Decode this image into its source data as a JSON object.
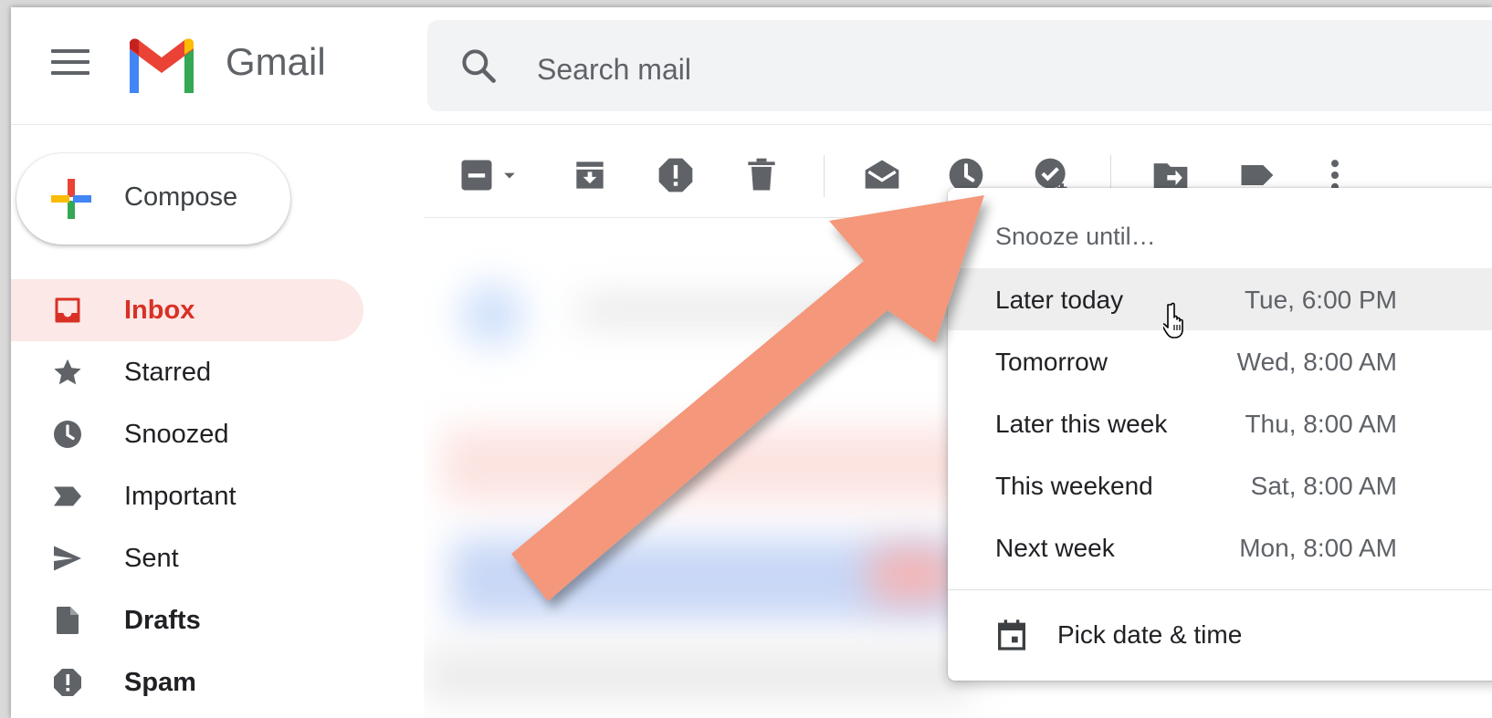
{
  "header": {
    "menu_icon": "hamburger-menu-icon",
    "app_title": "Gmail",
    "search": {
      "placeholder": "Search mail",
      "icon": "search-icon"
    }
  },
  "sidebar": {
    "compose_label": "Compose",
    "items": [
      {
        "label": "Inbox",
        "icon": "inbox-icon",
        "active": true
      },
      {
        "label": "Starred",
        "icon": "star-icon"
      },
      {
        "label": "Snoozed",
        "icon": "clock-icon"
      },
      {
        "label": "Important",
        "icon": "important-icon"
      },
      {
        "label": "Sent",
        "icon": "send-icon"
      },
      {
        "label": "Drafts",
        "icon": "draft-icon",
        "bold": true
      },
      {
        "label": "Spam",
        "icon": "spam-icon",
        "bold": true
      }
    ]
  },
  "toolbar": {
    "buttons": [
      "select-checkbox",
      "select-dropdown",
      "archive",
      "report-spam",
      "delete",
      "mark-as-read",
      "snooze",
      "add-to-tasks",
      "move-to",
      "labels",
      "more"
    ]
  },
  "snooze_menu": {
    "title": "Snooze until…",
    "options": [
      {
        "label": "Later today",
        "time": "Tue, 6:00 PM",
        "highlighted": true
      },
      {
        "label": "Tomorrow",
        "time": "Wed, 8:00 AM"
      },
      {
        "label": "Later this week",
        "time": "Thu, 8:00 AM"
      },
      {
        "label": "This weekend",
        "time": "Sat, 8:00 AM"
      },
      {
        "label": "Next week",
        "time": "Mon, 8:00 AM"
      }
    ],
    "pick_label": "Pick date & time"
  },
  "colors": {
    "accent_red": "#d93025",
    "active_bg": "#fce8e6",
    "icon_gray": "#5f6368",
    "arrow": "#f4977a"
  }
}
